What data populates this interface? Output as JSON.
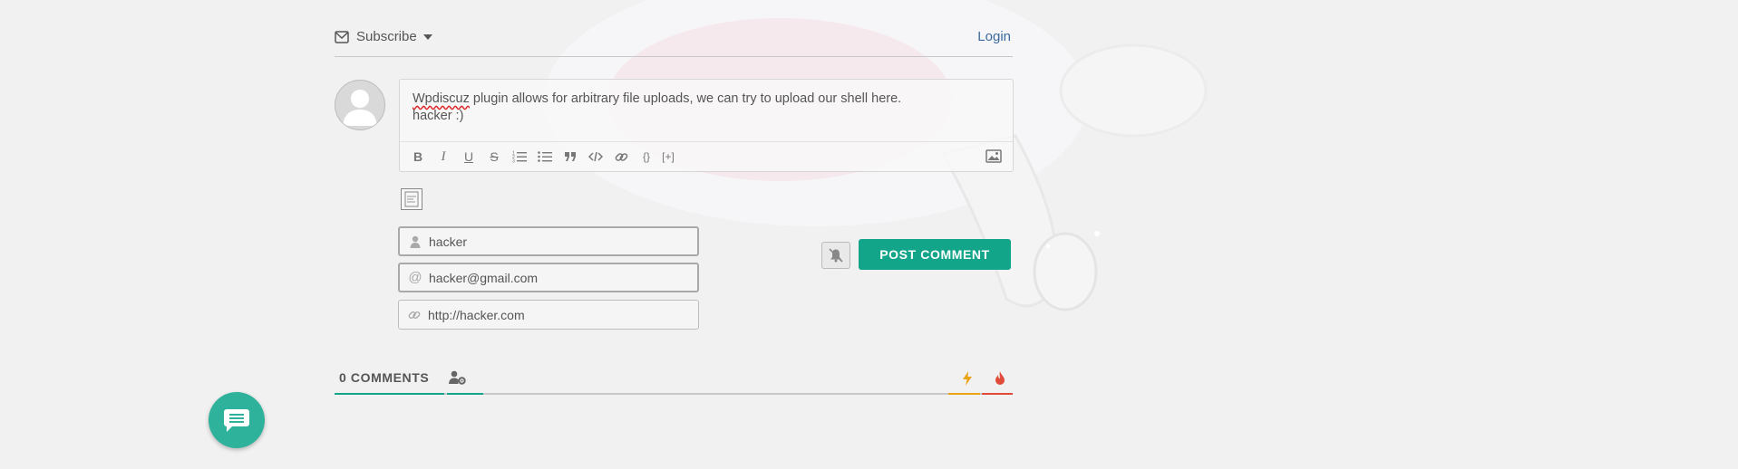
{
  "colors": {
    "accent": "#12a58a",
    "link": "#3b6a9d",
    "flash": "#e8a317",
    "hot": "#e04b3a",
    "fab": "#2eb29b"
  },
  "header": {
    "subscribe_label": "Subscribe",
    "login_label": "Login"
  },
  "editor": {
    "text_parts": {
      "misspelled": "Wpdiscuz",
      "rest": " plugin allows for arbitrary file uploads, we can try to upload our shell here.\nhacker :)"
    },
    "toolbar": [
      {
        "name": "bold",
        "icon": "bold-icon",
        "glyph": "B"
      },
      {
        "name": "italic",
        "icon": "italic-icon",
        "glyph": "I"
      },
      {
        "name": "underline",
        "icon": "underline-icon",
        "glyph": "U"
      },
      {
        "name": "strike",
        "icon": "strikethrough-icon",
        "glyph": "S"
      },
      {
        "name": "ordered-list",
        "icon": "ordered-list-icon",
        "glyph": ""
      },
      {
        "name": "unordered-list",
        "icon": "unordered-list-icon",
        "glyph": ""
      },
      {
        "name": "blockquote",
        "icon": "quote-icon",
        "glyph": ""
      },
      {
        "name": "code",
        "icon": "code-icon",
        "glyph": ""
      },
      {
        "name": "link",
        "icon": "link-icon",
        "glyph": ""
      },
      {
        "name": "source-code",
        "icon": "curly-braces-icon",
        "glyph": "{}"
      },
      {
        "name": "spoiler",
        "icon": "spoiler-icon",
        "glyph": "[+]"
      }
    ]
  },
  "form": {
    "name_value": "hacker",
    "email_value": "hacker@gmail.com",
    "website_value": "http://hacker.com",
    "post_label": "POST COMMENT"
  },
  "comments": {
    "count_label": "0 COMMENTS"
  }
}
